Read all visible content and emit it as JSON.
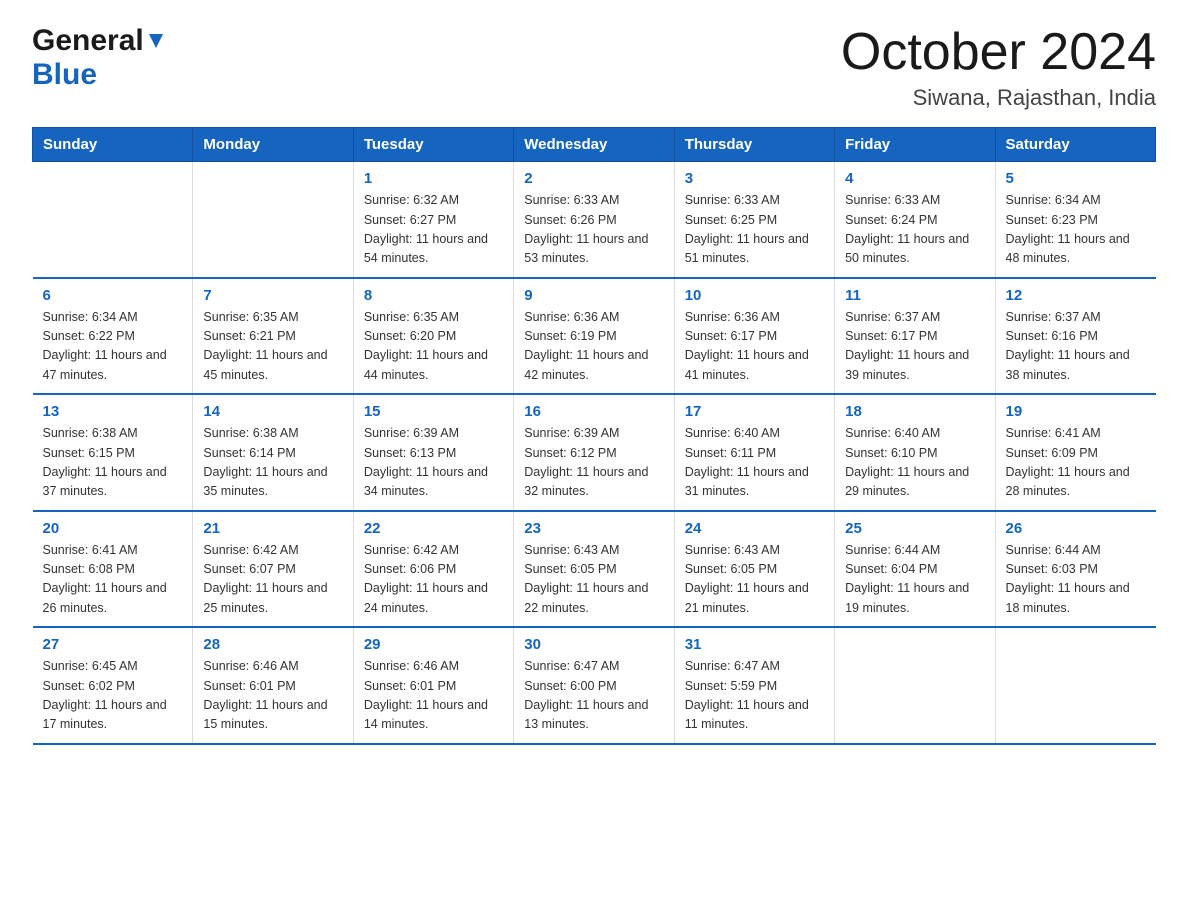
{
  "logo": {
    "general": "General",
    "blue": "Blue"
  },
  "title": "October 2024",
  "location": "Siwana, Rajasthan, India",
  "days_of_week": [
    "Sunday",
    "Monday",
    "Tuesday",
    "Wednesday",
    "Thursday",
    "Friday",
    "Saturday"
  ],
  "weeks": [
    [
      {
        "day": "",
        "info": ""
      },
      {
        "day": "",
        "info": ""
      },
      {
        "day": "1",
        "info": "Sunrise: 6:32 AM\nSunset: 6:27 PM\nDaylight: 11 hours\nand 54 minutes."
      },
      {
        "day": "2",
        "info": "Sunrise: 6:33 AM\nSunset: 6:26 PM\nDaylight: 11 hours\nand 53 minutes."
      },
      {
        "day": "3",
        "info": "Sunrise: 6:33 AM\nSunset: 6:25 PM\nDaylight: 11 hours\nand 51 minutes."
      },
      {
        "day": "4",
        "info": "Sunrise: 6:33 AM\nSunset: 6:24 PM\nDaylight: 11 hours\nand 50 minutes."
      },
      {
        "day": "5",
        "info": "Sunrise: 6:34 AM\nSunset: 6:23 PM\nDaylight: 11 hours\nand 48 minutes."
      }
    ],
    [
      {
        "day": "6",
        "info": "Sunrise: 6:34 AM\nSunset: 6:22 PM\nDaylight: 11 hours\nand 47 minutes."
      },
      {
        "day": "7",
        "info": "Sunrise: 6:35 AM\nSunset: 6:21 PM\nDaylight: 11 hours\nand 45 minutes."
      },
      {
        "day": "8",
        "info": "Sunrise: 6:35 AM\nSunset: 6:20 PM\nDaylight: 11 hours\nand 44 minutes."
      },
      {
        "day": "9",
        "info": "Sunrise: 6:36 AM\nSunset: 6:19 PM\nDaylight: 11 hours\nand 42 minutes."
      },
      {
        "day": "10",
        "info": "Sunrise: 6:36 AM\nSunset: 6:17 PM\nDaylight: 11 hours\nand 41 minutes."
      },
      {
        "day": "11",
        "info": "Sunrise: 6:37 AM\nSunset: 6:17 PM\nDaylight: 11 hours\nand 39 minutes."
      },
      {
        "day": "12",
        "info": "Sunrise: 6:37 AM\nSunset: 6:16 PM\nDaylight: 11 hours\nand 38 minutes."
      }
    ],
    [
      {
        "day": "13",
        "info": "Sunrise: 6:38 AM\nSunset: 6:15 PM\nDaylight: 11 hours\nand 37 minutes."
      },
      {
        "day": "14",
        "info": "Sunrise: 6:38 AM\nSunset: 6:14 PM\nDaylight: 11 hours\nand 35 minutes."
      },
      {
        "day": "15",
        "info": "Sunrise: 6:39 AM\nSunset: 6:13 PM\nDaylight: 11 hours\nand 34 minutes."
      },
      {
        "day": "16",
        "info": "Sunrise: 6:39 AM\nSunset: 6:12 PM\nDaylight: 11 hours\nand 32 minutes."
      },
      {
        "day": "17",
        "info": "Sunrise: 6:40 AM\nSunset: 6:11 PM\nDaylight: 11 hours\nand 31 minutes."
      },
      {
        "day": "18",
        "info": "Sunrise: 6:40 AM\nSunset: 6:10 PM\nDaylight: 11 hours\nand 29 minutes."
      },
      {
        "day": "19",
        "info": "Sunrise: 6:41 AM\nSunset: 6:09 PM\nDaylight: 11 hours\nand 28 minutes."
      }
    ],
    [
      {
        "day": "20",
        "info": "Sunrise: 6:41 AM\nSunset: 6:08 PM\nDaylight: 11 hours\nand 26 minutes."
      },
      {
        "day": "21",
        "info": "Sunrise: 6:42 AM\nSunset: 6:07 PM\nDaylight: 11 hours\nand 25 minutes."
      },
      {
        "day": "22",
        "info": "Sunrise: 6:42 AM\nSunset: 6:06 PM\nDaylight: 11 hours\nand 24 minutes."
      },
      {
        "day": "23",
        "info": "Sunrise: 6:43 AM\nSunset: 6:05 PM\nDaylight: 11 hours\nand 22 minutes."
      },
      {
        "day": "24",
        "info": "Sunrise: 6:43 AM\nSunset: 6:05 PM\nDaylight: 11 hours\nand 21 minutes."
      },
      {
        "day": "25",
        "info": "Sunrise: 6:44 AM\nSunset: 6:04 PM\nDaylight: 11 hours\nand 19 minutes."
      },
      {
        "day": "26",
        "info": "Sunrise: 6:44 AM\nSunset: 6:03 PM\nDaylight: 11 hours\nand 18 minutes."
      }
    ],
    [
      {
        "day": "27",
        "info": "Sunrise: 6:45 AM\nSunset: 6:02 PM\nDaylight: 11 hours\nand 17 minutes."
      },
      {
        "day": "28",
        "info": "Sunrise: 6:46 AM\nSunset: 6:01 PM\nDaylight: 11 hours\nand 15 minutes."
      },
      {
        "day": "29",
        "info": "Sunrise: 6:46 AM\nSunset: 6:01 PM\nDaylight: 11 hours\nand 14 minutes."
      },
      {
        "day": "30",
        "info": "Sunrise: 6:47 AM\nSunset: 6:00 PM\nDaylight: 11 hours\nand 13 minutes."
      },
      {
        "day": "31",
        "info": "Sunrise: 6:47 AM\nSunset: 5:59 PM\nDaylight: 11 hours\nand 11 minutes."
      },
      {
        "day": "",
        "info": ""
      },
      {
        "day": "",
        "info": ""
      }
    ]
  ]
}
